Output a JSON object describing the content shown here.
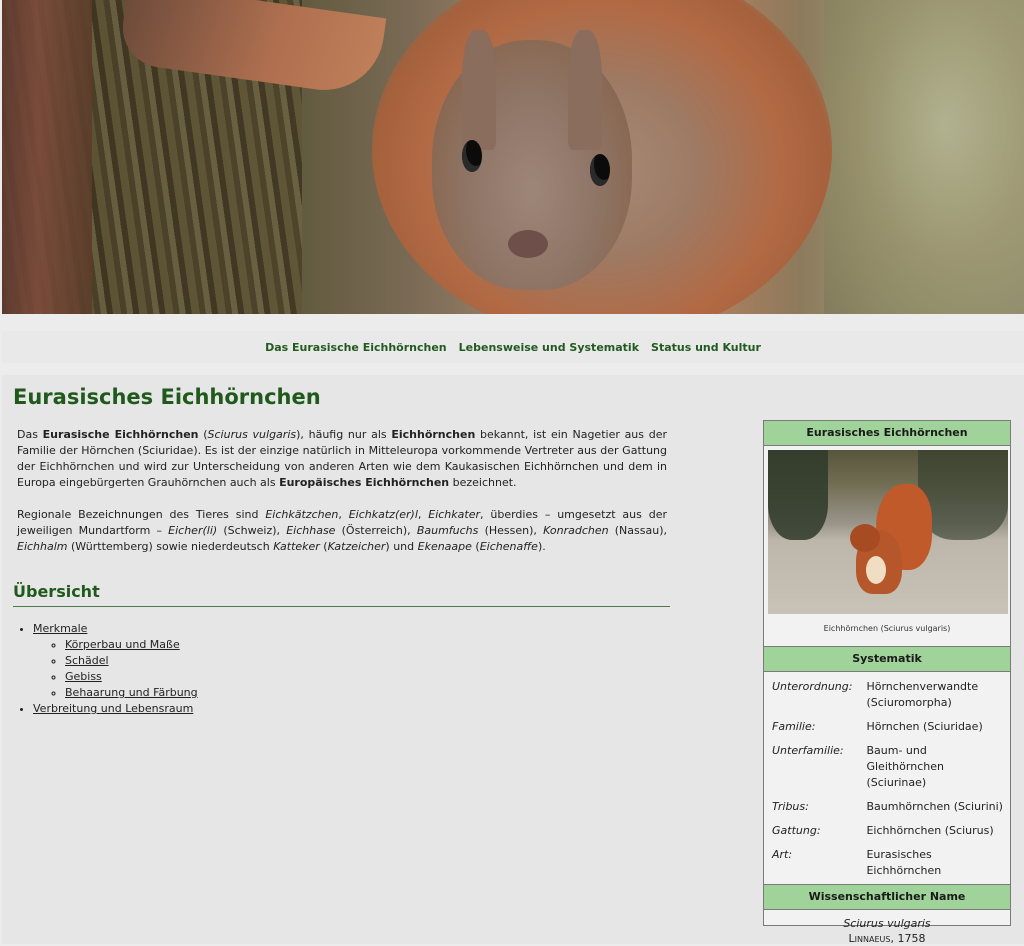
{
  "nav": {
    "items": [
      "Das Eurasische Eichhörnchen",
      "Lebensweise und Systematik",
      "Status und Kultur"
    ]
  },
  "page": {
    "title": "Eurasisches Eichhörnchen",
    "intro1": [
      {
        "t": "Das "
      },
      {
        "t": "Eurasische Eichhörnchen",
        "b": true
      },
      {
        "t": " ("
      },
      {
        "t": "Sciurus vulgaris",
        "i": true
      },
      {
        "t": "), häufig nur als "
      },
      {
        "t": "Eichhörnchen",
        "b": true
      },
      {
        "t": " bekannt, ist ein Nagetier aus der Familie der Hörnchen (Sciuridae). Es ist der einzige natürlich in Mitteleuropa vorkommende Vertreter aus der Gattung der Eichhörnchen und wird zur Unterscheidung von anderen Arten wie dem Kaukasischen Eichhörnchen und dem in Europa eingebürgerten Grauhörnchen auch als "
      },
      {
        "t": "Europäisches Eichhörnchen",
        "b": true
      },
      {
        "t": " bezeichnet."
      }
    ],
    "intro2": [
      {
        "t": "Regionale Bezeichnungen des Tieres sind "
      },
      {
        "t": "Eichkätzchen",
        "i": true
      },
      {
        "t": ", "
      },
      {
        "t": "Eichkatz(er)l",
        "i": true
      },
      {
        "t": ", "
      },
      {
        "t": "Eichkater",
        "i": true
      },
      {
        "t": ", überdies – umgesetzt aus der jeweiligen Mundartform – "
      },
      {
        "t": "Eicher(li)",
        "i": true
      },
      {
        "t": " (Schweiz), "
      },
      {
        "t": "Eichhase",
        "i": true
      },
      {
        "t": " (Österreich), "
      },
      {
        "t": "Baumfuchs",
        "i": true
      },
      {
        "t": " (Hessen), "
      },
      {
        "t": "Konradchen",
        "i": true
      },
      {
        "t": " (Nassau), "
      },
      {
        "t": "Eichhalm",
        "i": true
      },
      {
        "t": " (Württemberg) sowie niederdeutsch "
      },
      {
        "t": "Katteker",
        "i": true
      },
      {
        "t": " ("
      },
      {
        "t": "Katzeicher",
        "i": true
      },
      {
        "t": ") und "
      },
      {
        "t": "Ekenaape",
        "i": true
      },
      {
        "t": " ("
      },
      {
        "t": "Eichenaffe",
        "i": true
      },
      {
        "t": ")."
      }
    ],
    "overview_heading": "Übersicht",
    "toc": {
      "merkmale": "Merkmale",
      "sub": [
        "Körperbau und Maße",
        "Schädel",
        "Gebiss",
        "Behaarung und Färbung"
      ],
      "verbreitung": "Verbreitung und Lebensraum"
    }
  },
  "infobox": {
    "title": "Eurasisches Eichhörnchen",
    "caption": "Eichhörnchen (Sciurus vulgaris)",
    "systematik_heading": "Systematik",
    "rows": [
      {
        "k": "Unterordnung:",
        "v": "Hörnchenverwandte (Sciuromorpha)"
      },
      {
        "k": "Familie:",
        "v": "Hörnchen (Sciuridae)"
      },
      {
        "k": "Unterfamilie:",
        "v": "Baum- und Gleithörnchen (Sciurinae)"
      },
      {
        "k": "Tribus:",
        "v": "Baumhörnchen (Sciurini)"
      },
      {
        "k": "Gattung:",
        "v": "Eichhörnchen (Sciurus)"
      },
      {
        "k": "Art:",
        "v": "Eurasisches Eichhörnchen"
      }
    ],
    "sci_heading": "Wissenschaftlicher Name",
    "sci_name": "Sciurus vulgaris",
    "sci_author": "Linnaeus, 1758"
  },
  "colors": {
    "heading": "#1f5a1c",
    "infobox_header": "#9fd39a",
    "nav_link": "#215a1f"
  }
}
